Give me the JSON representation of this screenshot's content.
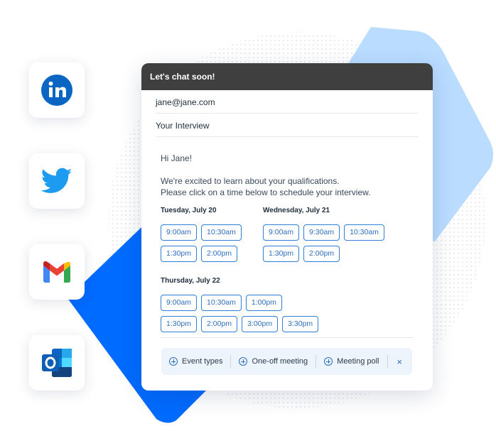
{
  "email": {
    "header_title": "Let's chat soon!",
    "to": "jane@jane.com",
    "subject": "Your Interview",
    "greeting": "Hi Jane!",
    "line1": "We're excited to learn about your qualifications.",
    "line2": "Please click on a time below to schedule your interview."
  },
  "days": [
    {
      "label": "Tuesday, July 20",
      "rows": [
        [
          "9:00am",
          "10:30am"
        ],
        [
          "1:30pm",
          "2:00pm"
        ]
      ]
    },
    {
      "label": "Wednesday, July 21",
      "rows": [
        [
          "9:00am",
          "9:30am",
          "10:30am"
        ],
        [
          "1:30pm",
          "2:00pm"
        ]
      ]
    },
    {
      "label": "Thursday, July 22",
      "rows": [
        [
          "9:00am",
          "10:30am",
          "1:00pm"
        ],
        [
          "1:30pm",
          "2:00pm",
          "3:00pm",
          "3:30pm"
        ]
      ]
    }
  ],
  "toolbar": {
    "event_types": "Event types",
    "one_off": "One-off meeting",
    "poll": "Meeting poll",
    "close": "×"
  },
  "apps": [
    {
      "name": "LinkedIn",
      "icon": "linkedin-icon",
      "color": "#0a66c2"
    },
    {
      "name": "Twitter",
      "icon": "twitter-icon",
      "color": "#1d9bf0"
    },
    {
      "name": "Gmail",
      "icon": "gmail-icon",
      "color": "#ea4335"
    },
    {
      "name": "Outlook",
      "icon": "outlook-icon",
      "color": "#0a64c5"
    }
  ],
  "colors": {
    "accent_blue": "#006bff",
    "light_blue": "#b9dcff",
    "header_dark": "#3f3f3f",
    "slot_border": "#2f80d8"
  }
}
